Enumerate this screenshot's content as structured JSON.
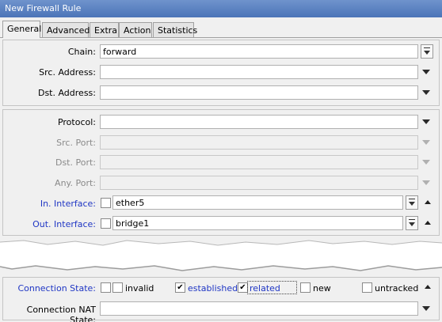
{
  "window": {
    "title": "New Firewall Rule"
  },
  "tabs": [
    {
      "label": "General",
      "active": true
    },
    {
      "label": "Advanced",
      "active": false
    },
    {
      "label": "Extra",
      "active": false
    },
    {
      "label": "Action",
      "active": false
    },
    {
      "label": "Statistics",
      "active": false
    }
  ],
  "general": {
    "chain": {
      "label": "Chain:",
      "value": "forward"
    },
    "src_address": {
      "label": "Src. Address:",
      "value": ""
    },
    "dst_address": {
      "label": "Dst. Address:",
      "value": ""
    },
    "protocol": {
      "label": "Protocol:",
      "value": ""
    },
    "src_port": {
      "label": "Src. Port:",
      "value": ""
    },
    "dst_port": {
      "label": "Dst. Port:",
      "value": ""
    },
    "any_port": {
      "label": "Any. Port:",
      "value": ""
    },
    "in_interface": {
      "label": "In. Interface:",
      "value": "ether5",
      "negate": false
    },
    "out_interface": {
      "label": "Out. Interface:",
      "value": "bridge1",
      "negate": false
    },
    "connection_state": {
      "label": "Connection State:",
      "options": [
        {
          "label": "invalid",
          "checked": false
        },
        {
          "label": "established",
          "checked": true
        },
        {
          "label": "related",
          "checked": true
        },
        {
          "label": "new",
          "checked": false
        },
        {
          "label": "untracked",
          "checked": false
        }
      ]
    },
    "connection_nat_state": {
      "label": "Connection NAT State:",
      "value": ""
    }
  },
  "colors": {
    "title_bar": "#5a7fbf",
    "enabled_label": "#1f36c4",
    "disabled_label": "#8a8a8a"
  }
}
